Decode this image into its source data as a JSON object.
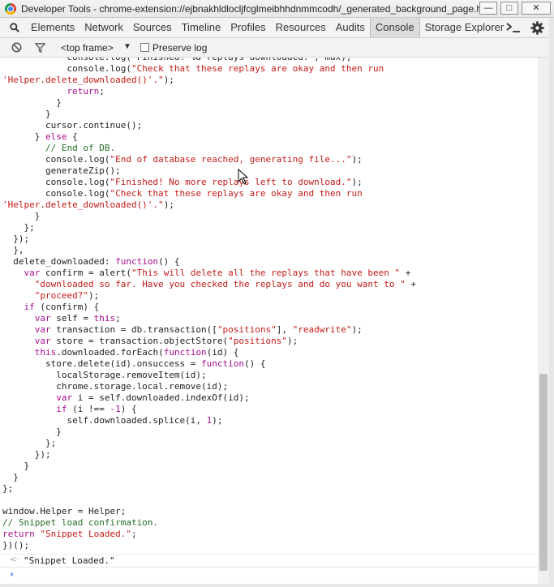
{
  "window": {
    "title": "Developer Tools - chrome-extension://ejbnakhldlocljfcglmeibhhdnmmcodh/_generated_background_page.html",
    "minimize": "—",
    "maximize": "□",
    "close": "✕"
  },
  "tabs": [
    {
      "label": "Elements"
    },
    {
      "label": "Network"
    },
    {
      "label": "Sources"
    },
    {
      "label": "Timeline"
    },
    {
      "label": "Profiles"
    },
    {
      "label": "Resources"
    },
    {
      "label": "Audits"
    },
    {
      "label": "Console",
      "active": true
    },
    {
      "label": "Storage Explorer"
    }
  ],
  "filterbar": {
    "frame": "<top frame>",
    "dropdown": "▼",
    "preserve_log": "Preserve log",
    "preserve_checked": false
  },
  "icons": {
    "search": "search-icon",
    "drawer": "drawer-icon",
    "settings": "gear-icon",
    "clear": "clear-icon",
    "filter": "filter-icon"
  },
  "colors": {
    "keyword": "#aa0d91",
    "string": "#c41a16",
    "comment": "#236e25",
    "active_tab": "#dcdcdc"
  },
  "code_lines": [
    [
      {
        "t": "            console.log(\"Finished! %d replays downloaded.\", max);",
        "c": "p"
      }
    ],
    [
      {
        "t": "            console.log(",
        "c": "p"
      },
      {
        "t": "\"Check that these replays are okay and then run",
        "c": "s"
      }
    ],
    [
      {
        "t": "'Helper.delete_downloaded()'.\"",
        "c": "s"
      },
      {
        "t": ");",
        "c": "p"
      }
    ],
    [
      {
        "t": "            ",
        "c": "p"
      },
      {
        "t": "return",
        "c": "k"
      },
      {
        "t": ";",
        "c": "p"
      }
    ],
    [
      {
        "t": "          }",
        "c": "p"
      }
    ],
    [
      {
        "t": "        }",
        "c": "p"
      }
    ],
    [
      {
        "t": "        cursor.continue();",
        "c": "p"
      }
    ],
    [
      {
        "t": "      } ",
        "c": "p"
      },
      {
        "t": "else",
        "c": "k"
      },
      {
        "t": " {",
        "c": "p"
      }
    ],
    [
      {
        "t": "        ",
        "c": "p"
      },
      {
        "t": "// End of DB.",
        "c": "c"
      }
    ],
    [
      {
        "t": "        console.log(",
        "c": "p"
      },
      {
        "t": "\"End of database reached, generating file...\"",
        "c": "s"
      },
      {
        "t": ");",
        "c": "p"
      }
    ],
    [
      {
        "t": "        generateZip();",
        "c": "p"
      }
    ],
    [
      {
        "t": "        console.log(",
        "c": "p"
      },
      {
        "t": "\"Finished! No more replays left to download.\"",
        "c": "s"
      },
      {
        "t": ");",
        "c": "p"
      }
    ],
    [
      {
        "t": "        console.log(",
        "c": "p"
      },
      {
        "t": "\"Check that these replays are okay and then run",
        "c": "s"
      }
    ],
    [
      {
        "t": "'Helper.delete_downloaded()'.\"",
        "c": "s"
      },
      {
        "t": ");",
        "c": "p"
      }
    ],
    [
      {
        "t": "      }",
        "c": "p"
      }
    ],
    [
      {
        "t": "    };",
        "c": "p"
      }
    ],
    [
      {
        "t": "  });",
        "c": "p"
      }
    ],
    [
      {
        "t": "  },",
        "c": "p"
      }
    ],
    [
      {
        "t": "  delete_downloaded: ",
        "c": "p"
      },
      {
        "t": "function",
        "c": "k"
      },
      {
        "t": "() {",
        "c": "p"
      }
    ],
    [
      {
        "t": "    ",
        "c": "p"
      },
      {
        "t": "var",
        "c": "k"
      },
      {
        "t": " confirm = alert(",
        "c": "p"
      },
      {
        "t": "\"This will delete all the replays that have been \"",
        "c": "s"
      },
      {
        "t": " +",
        "c": "p"
      }
    ],
    [
      {
        "t": "      ",
        "c": "p"
      },
      {
        "t": "\"downloaded so far. Have you checked the replays and do you want to \"",
        "c": "s"
      },
      {
        "t": " +",
        "c": "p"
      }
    ],
    [
      {
        "t": "      ",
        "c": "p"
      },
      {
        "t": "\"proceed?\"",
        "c": "s"
      },
      {
        "t": ");",
        "c": "p"
      }
    ],
    [
      {
        "t": "    ",
        "c": "p"
      },
      {
        "t": "if",
        "c": "k"
      },
      {
        "t": " (confirm) {",
        "c": "p"
      }
    ],
    [
      {
        "t": "      ",
        "c": "p"
      },
      {
        "t": "var",
        "c": "k"
      },
      {
        "t": " self = ",
        "c": "p"
      },
      {
        "t": "this",
        "c": "k"
      },
      {
        "t": ";",
        "c": "p"
      }
    ],
    [
      {
        "t": "      ",
        "c": "p"
      },
      {
        "t": "var",
        "c": "k"
      },
      {
        "t": " transaction = db.transaction([",
        "c": "p"
      },
      {
        "t": "\"positions\"",
        "c": "s"
      },
      {
        "t": "], ",
        "c": "p"
      },
      {
        "t": "\"readwrite\"",
        "c": "s"
      },
      {
        "t": ");",
        "c": "p"
      }
    ],
    [
      {
        "t": "      ",
        "c": "p"
      },
      {
        "t": "var",
        "c": "k"
      },
      {
        "t": " store = transaction.objectStore(",
        "c": "p"
      },
      {
        "t": "\"positions\"",
        "c": "s"
      },
      {
        "t": ");",
        "c": "p"
      }
    ],
    [
      {
        "t": "      ",
        "c": "p"
      },
      {
        "t": "this",
        "c": "k"
      },
      {
        "t": ".downloaded.forEach(",
        "c": "p"
      },
      {
        "t": "function",
        "c": "k"
      },
      {
        "t": "(id) {",
        "c": "p"
      }
    ],
    [
      {
        "t": "        store.delete(id).onsuccess = ",
        "c": "p"
      },
      {
        "t": "function",
        "c": "k"
      },
      {
        "t": "() {",
        "c": "p"
      }
    ],
    [
      {
        "t": "          localStorage.removeItem(id);",
        "c": "p"
      }
    ],
    [
      {
        "t": "          chrome.storage.local.remove(id);",
        "c": "p"
      }
    ],
    [
      {
        "t": "          ",
        "c": "p"
      },
      {
        "t": "var",
        "c": "k"
      },
      {
        "t": " i = self.downloaded.indexOf(id);",
        "c": "p"
      }
    ],
    [
      {
        "t": "          ",
        "c": "p"
      },
      {
        "t": "if",
        "c": "k"
      },
      {
        "t": " (i !== ",
        "c": "p"
      },
      {
        "t": "-1",
        "c": "k"
      },
      {
        "t": ") {",
        "c": "p"
      }
    ],
    [
      {
        "t": "            self.downloaded.splice(i, ",
        "c": "p"
      },
      {
        "t": "1",
        "c": "k"
      },
      {
        "t": ");",
        "c": "p"
      }
    ],
    [
      {
        "t": "          }",
        "c": "p"
      }
    ],
    [
      {
        "t": "        };",
        "c": "p"
      }
    ],
    [
      {
        "t": "      });",
        "c": "p"
      }
    ],
    [
      {
        "t": "    }",
        "c": "p"
      }
    ],
    [
      {
        "t": "  }",
        "c": "p"
      }
    ],
    [
      {
        "t": "};",
        "c": "p"
      }
    ],
    [
      {
        "t": "",
        "c": "p"
      }
    ],
    [
      {
        "t": "window.Helper = Helper;",
        "c": "p"
      }
    ],
    [
      {
        "t": "// Snippet load confirmation.",
        "c": "c"
      }
    ],
    [
      {
        "t": "return",
        "c": "k"
      },
      {
        "t": " ",
        "c": "p"
      },
      {
        "t": "\"Snippet Loaded.\"",
        "c": "s"
      },
      {
        "t": ";",
        "c": "p"
      }
    ],
    [
      {
        "t": "})();",
        "c": "p"
      }
    ]
  ],
  "result": {
    "arrow": "<·",
    "text": "\"Snippet Loaded.\""
  },
  "prompt": {
    "chevron": "›",
    "value": ""
  }
}
